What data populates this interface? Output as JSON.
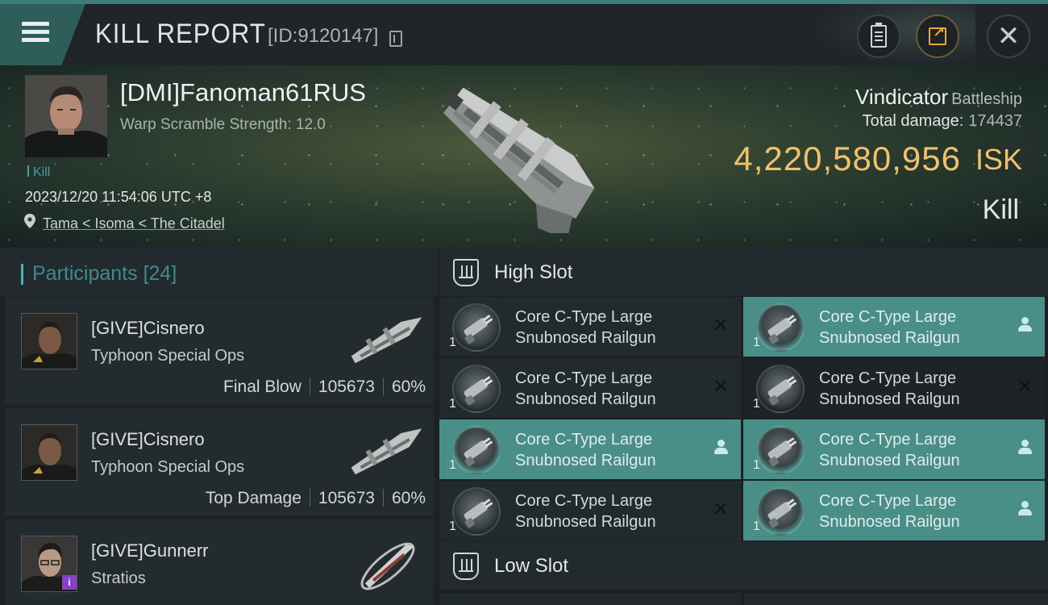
{
  "header": {
    "title": "KILL REPORT",
    "report_id": "[ID:9120147]"
  },
  "victim": {
    "name": "[DMI]Fanoman61RUS",
    "subtitle": "Warp Scramble Strength: 12.0",
    "tag": "Kill",
    "timestamp": "2023/12/20 11:54:06 UTC +8",
    "location": "Tama < Isoma < The Citadel",
    "ship_name": "Vindicator",
    "ship_class": "Battleship",
    "total_damage_label": "Total damage:",
    "total_damage": "174437",
    "isk_value": "4,220,580,956",
    "isk_label": "ISK",
    "result": "Kill"
  },
  "participants": {
    "title": "Participants",
    "count": "[24]",
    "items": [
      {
        "name": "[GIVE]Cisnero",
        "ship": "Typhoon Special Ops",
        "role": "Final Blow",
        "damage": "105673",
        "percent": "60%"
      },
      {
        "name": "[GIVE]Cisnero",
        "ship": "Typhoon Special Ops",
        "role": "Top Damage",
        "damage": "105673",
        "percent": "60%"
      },
      {
        "name": "[GIVE]Gunnerr",
        "ship": "Stratios",
        "badge": "i"
      }
    ]
  },
  "high_slot": {
    "title": "High Slot",
    "modules": [
      {
        "qty": "1",
        "line1": "Core C-Type Large",
        "line2": "Snubnosed Railgun",
        "status": "destroyed"
      },
      {
        "qty": "1",
        "line1": "Core C-Type Large",
        "line2": "Snubnosed Railgun",
        "status": "dropped"
      },
      {
        "qty": "1",
        "line1": "Core C-Type Large",
        "line2": "Snubnosed Railgun",
        "status": "destroyed"
      },
      {
        "qty": "1",
        "line1": "Core C-Type Large",
        "line2": "Snubnosed Railgun",
        "status": "destroyed"
      },
      {
        "qty": "1",
        "line1": "Core C-Type Large",
        "line2": "Snubnosed Railgun",
        "status": "dropped"
      },
      {
        "qty": "1",
        "line1": "Core C-Type Large",
        "line2": "Snubnosed Railgun",
        "status": "dropped"
      },
      {
        "qty": "1",
        "line1": "Core C-Type Large",
        "line2": "Snubnosed Railgun",
        "status": "destroyed"
      },
      {
        "qty": "1",
        "line1": "Core C-Type Large",
        "line2": "Snubnosed Railgun",
        "status": "dropped"
      }
    ]
  },
  "low_slot": {
    "title": "Low Slot"
  },
  "icons": {
    "destroyed": "x-icon",
    "dropped": "user-icon"
  },
  "colors": {
    "accent_teal": "#4a8e88",
    "isk_gold": "#f0c26a",
    "share_orange": "#e9a63b"
  }
}
